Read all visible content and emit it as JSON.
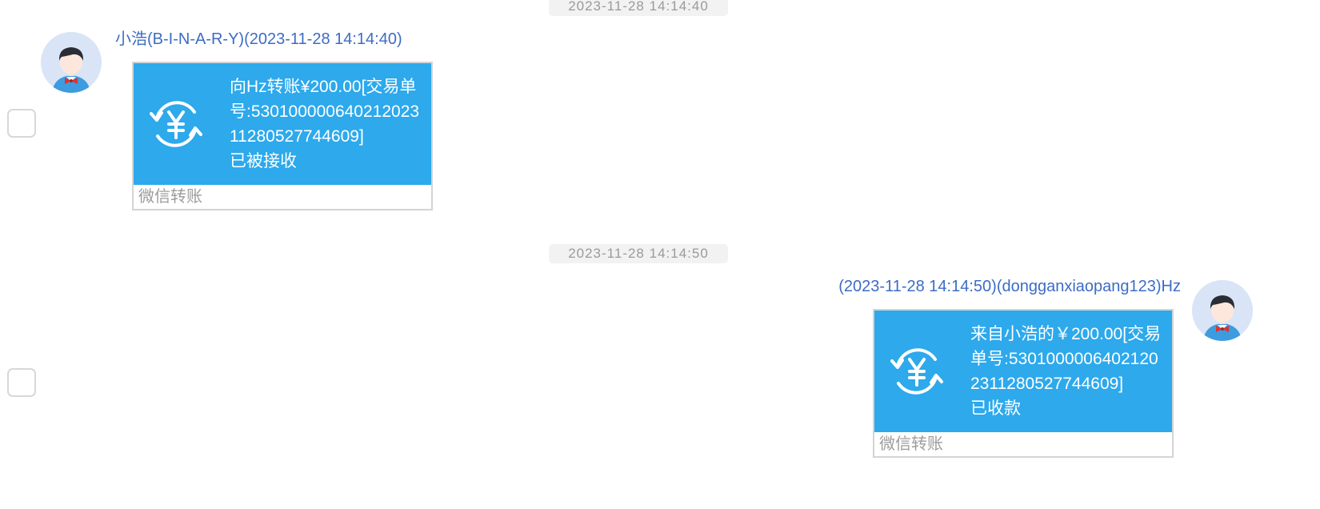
{
  "messages": [
    {
      "time": "2023-11-28 14:14:40",
      "sender": "小浩(B-I-N-A-R-Y)(2023-11-28 14:14:40)",
      "direction": "incoming",
      "icon": "yuan-transfer-icon",
      "text": "向Hz转账¥200.00[交易单号:53010000064021202311280527744609]",
      "status": "已被接收",
      "footer": "微信转账"
    },
    {
      "time": "2023-11-28 14:14:50",
      "sender": "(2023-11-28 14:14:50)(dongganxiaopang123)Hz",
      "direction": "outgoing",
      "icon": "yuan-transfer-icon",
      "text": "来自小浩的￥200.00[交易单号:53010000064021202311280527744609]",
      "status": "已收款",
      "footer": "微信转账"
    }
  ],
  "colors": {
    "card_bg": "#2da9ec",
    "sender_name": "#3d6cc4",
    "timestamp_bg": "#f2f2f2",
    "timestamp_text": "#9a9a9a"
  }
}
